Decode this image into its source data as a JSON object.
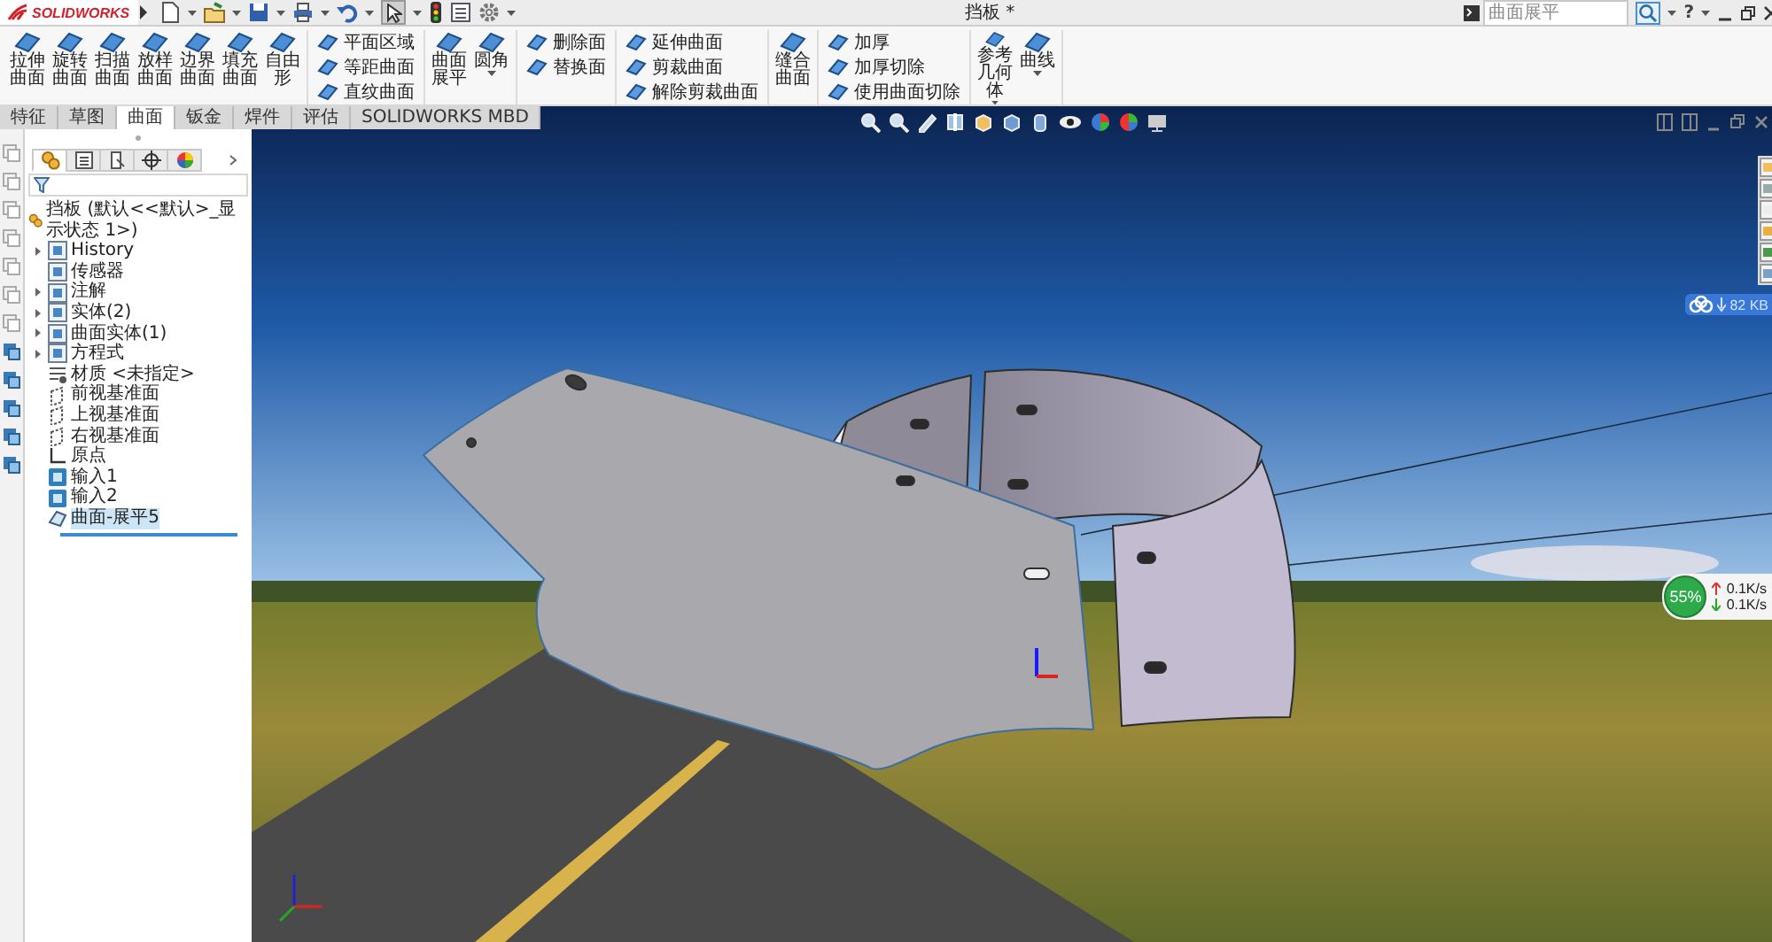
{
  "title_bar": {
    "app_name": "SOLIDWORKS",
    "document_title": "挡板 *",
    "search": {
      "placeholder": "曲面展平"
    },
    "help": "?"
  },
  "ribbon": {
    "groups": [
      {
        "kind": "large",
        "items": [
          {
            "label": "拉伸曲面",
            "dropdown": false
          },
          {
            "label": "旋转曲面",
            "dropdown": false
          },
          {
            "label": "扫描曲面",
            "dropdown": false
          },
          {
            "label": "放样曲面",
            "dropdown": false
          },
          {
            "label": "边界曲面",
            "dropdown": false
          },
          {
            "label": "填充曲面",
            "dropdown": false
          },
          {
            "label": "自由形",
            "dropdown": false
          }
        ]
      },
      {
        "kind": "small",
        "items": [
          {
            "label": "平面区域"
          },
          {
            "label": "等距曲面"
          },
          {
            "label": "直纹曲面"
          }
        ]
      },
      {
        "kind": "large",
        "items": [
          {
            "label": "曲面展平",
            "dropdown": false
          },
          {
            "label": "圆角",
            "dropdown": true
          }
        ]
      },
      {
        "kind": "small",
        "items": [
          {
            "label": "删除面"
          },
          {
            "label": "替换面"
          }
        ]
      },
      {
        "kind": "small",
        "items": [
          {
            "label": "延伸曲面"
          },
          {
            "label": "剪裁曲面"
          },
          {
            "label": "解除剪裁曲面"
          }
        ]
      },
      {
        "kind": "large",
        "items": [
          {
            "label": "缝合曲面",
            "dropdown": false
          }
        ]
      },
      {
        "kind": "small",
        "items": [
          {
            "label": "加厚"
          },
          {
            "label": "加厚切除"
          },
          {
            "label": "使用曲面切除"
          }
        ]
      },
      {
        "kind": "large",
        "items": [
          {
            "label": "参考几何体",
            "dropdown": true
          },
          {
            "label": "曲线",
            "dropdown": true
          }
        ]
      }
    ]
  },
  "tabs": [
    {
      "label": "特征",
      "selected": false
    },
    {
      "label": "草图",
      "selected": false
    },
    {
      "label": "曲面",
      "selected": true
    },
    {
      "label": "钣金",
      "selected": false
    },
    {
      "label": "焊件",
      "selected": false
    },
    {
      "label": "评估",
      "selected": false
    },
    {
      "label": "SOLIDWORKS MBD",
      "selected": false
    }
  ],
  "feature_manager": {
    "panel_tabs": [
      {
        "selected": true
      },
      {
        "selected": false
      },
      {
        "selected": false
      },
      {
        "selected": false
      },
      {
        "selected": false
      }
    ],
    "root": "挡板 (默认<<默认>_显示状态 1>)",
    "items": [
      {
        "kind": "folder",
        "label": "History",
        "expandable": true,
        "selected": false
      },
      {
        "kind": "folder",
        "label": "传感器",
        "expandable": false,
        "selected": false
      },
      {
        "kind": "folder",
        "label": "注解",
        "expandable": true,
        "selected": false
      },
      {
        "kind": "folder",
        "label": "实体(2)",
        "expandable": true,
        "selected": false
      },
      {
        "kind": "folder",
        "label": "曲面实体(1)",
        "expandable": true,
        "selected": false
      },
      {
        "kind": "folder",
        "label": "方程式",
        "expandable": true,
        "selected": false
      },
      {
        "kind": "material",
        "label": "材质 <未指定>",
        "expandable": false,
        "selected": false
      },
      {
        "kind": "plane",
        "label": "前视基准面",
        "expandable": false,
        "selected": false
      },
      {
        "kind": "plane",
        "label": "上视基准面",
        "expandable": false,
        "selected": false
      },
      {
        "kind": "plane",
        "label": "右视基准面",
        "expandable": false,
        "selected": false
      },
      {
        "kind": "origin",
        "label": "原点",
        "expandable": false,
        "selected": false
      },
      {
        "kind": "import",
        "label": "输入1",
        "expandable": false,
        "selected": false
      },
      {
        "kind": "import",
        "label": "输入2",
        "expandable": false,
        "selected": false
      },
      {
        "kind": "feature",
        "label": "曲面-展平5",
        "expandable": false,
        "selected": true
      }
    ]
  },
  "viewport": {
    "cloud_widget": {
      "size": "82 KB"
    },
    "network_widget": {
      "percent": "55%",
      "upload": "0.1K/s",
      "download": "0.1K/s"
    }
  }
}
